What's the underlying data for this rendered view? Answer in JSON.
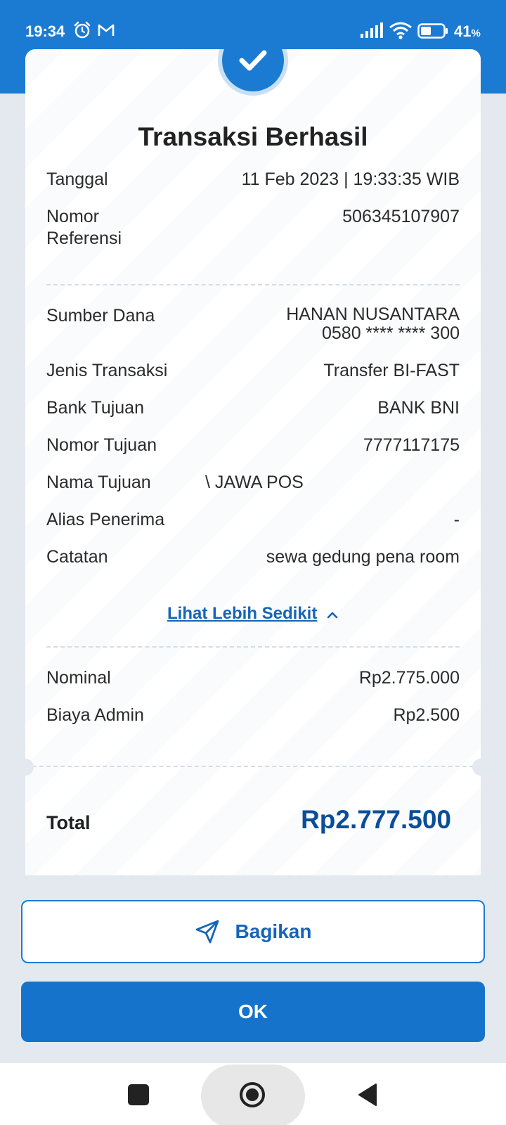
{
  "status_bar": {
    "time": "19:34",
    "battery_value": "41",
    "battery_unit": "%",
    "icons": [
      "alarm-icon",
      "gmail-icon",
      "signal-icon",
      "wifi-icon",
      "battery-icon"
    ]
  },
  "colors": {
    "primary": "#1b7bd3",
    "total_amount": "#0a4e9a",
    "background": "#e3e9ef"
  },
  "receipt": {
    "title": "Transaksi Berhasil",
    "date_label": "Tanggal",
    "date_value": "11 Feb 2023 | 19:33:35 WIB",
    "ref_label_line1": "Nomor",
    "ref_label_line2": "Referensi",
    "ref_value": "506345107907",
    "source_label": "Sumber Dana",
    "source_name": "HANAN NUSANTARA",
    "source_account": "0580 **** **** 300",
    "type_label": "Jenis Transaksi",
    "type_value": "Transfer BI-FAST",
    "bank_label": "Bank Tujuan",
    "bank_value": "BANK BNI",
    "dest_number_label": "Nomor Tujuan",
    "dest_number_value": "7777117175",
    "dest_name_label": "Nama Tujuan",
    "dest_name_value": "\\ JAWA POS",
    "alias_label": "Alias Penerima",
    "alias_value": "-",
    "note_label": "Catatan",
    "note_value": "sewa gedung pena room",
    "see_less": "Lihat Lebih Sedikit",
    "nominal_label": "Nominal",
    "nominal_value": "Rp2.775.000",
    "admin_label": "Biaya Admin",
    "admin_value": "Rp2.500",
    "total_label": "Total",
    "total_value": "Rp2.777.500"
  },
  "actions": {
    "share_label": "Bagikan",
    "ok_label": "OK"
  },
  "nav": {
    "icons": [
      "recents-icon",
      "home-icon",
      "back-icon"
    ]
  }
}
